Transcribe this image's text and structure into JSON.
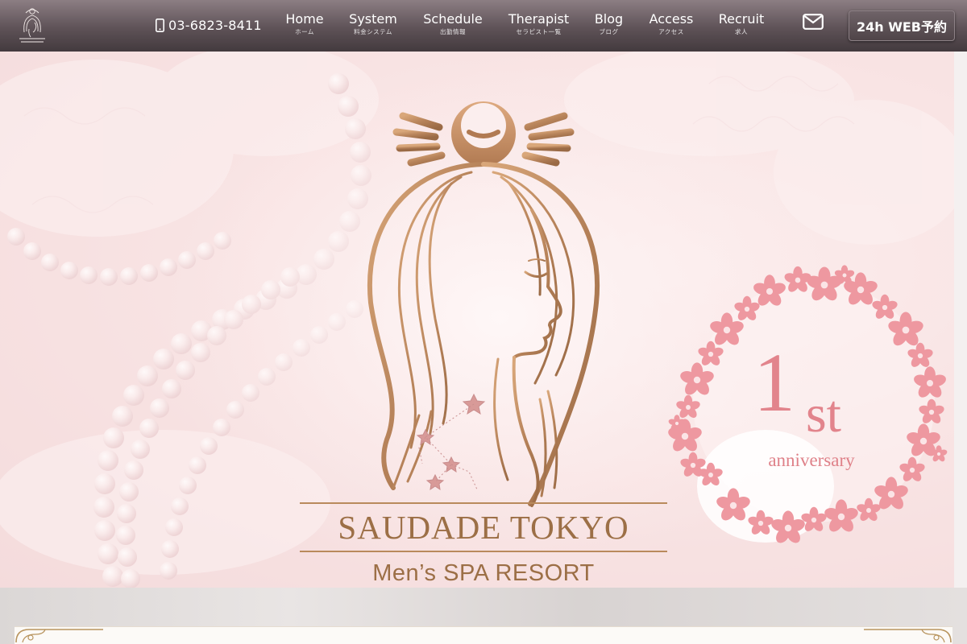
{
  "nav": {
    "phone": "03-6823-8411",
    "items": [
      {
        "en": "Home",
        "ja": "ホーム"
      },
      {
        "en": "System",
        "ja": "料金システム"
      },
      {
        "en": "Schedule",
        "ja": "出勤情報"
      },
      {
        "en": "Therapist",
        "ja": "セラピスト一覧"
      },
      {
        "en": "Blog",
        "ja": "ブログ"
      },
      {
        "en": "Access",
        "ja": "アクセス"
      },
      {
        "en": "Recruit",
        "ja": "求人"
      }
    ],
    "web_button": "24h WEB予約"
  },
  "hero": {
    "brand_title": "SAUDADE TOKYO",
    "brand_subtitle": "Men’s SPA RESORT",
    "anniversary_number": "1",
    "anniversary_suffix": "st",
    "anniversary_label": "anniversary"
  },
  "colors": {
    "nav_top": "#8c7e83",
    "nav_bottom": "#433a3e",
    "gold": "#b98a5c",
    "sakura_pink": "#e2848c",
    "hero_bg": "#f7dfdf"
  },
  "icons": [
    "mobile-phone-icon",
    "envelope-icon",
    "crest-logo-icon",
    "woman-face-logo-icon",
    "sakura-wreath-icon"
  ]
}
